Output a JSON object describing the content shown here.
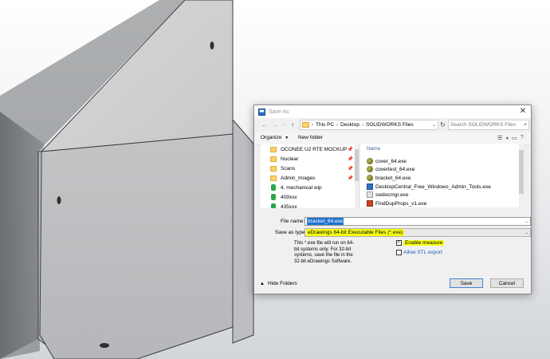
{
  "colors": {
    "selection": "#1f73d1",
    "highlight": "#f7ff16",
    "link": "#1b5fb4",
    "folder": "#ffd36b",
    "part_face": "#cfd0d2"
  },
  "dialog": {
    "title": "Save As",
    "close_label": "✕",
    "nav": {
      "back": "←",
      "forward": "→",
      "recent": "⌄",
      "up": "↑"
    },
    "address": {
      "crumbs": [
        "This PC",
        "Desktop",
        "SOLIDWORKS Files"
      ]
    },
    "search_placeholder": "Search SOLIDWORKS Files",
    "toolbar": {
      "organize": "Organize",
      "new_folder": "New folder"
    },
    "nav_pane": {
      "items": [
        {
          "label": "OCONEE U2 RTE MOCKUP",
          "icon": "folder-icon",
          "pinned": true
        },
        {
          "label": "Nuclear",
          "icon": "folder-icon",
          "pinned": true
        },
        {
          "label": "Scans",
          "icon": "folder-icon",
          "pinned": true
        },
        {
          "label": "Admin_Images",
          "icon": "folder-icon",
          "pinned": true
        },
        {
          "label": "4. mechanical wip",
          "icon": "sync-folder-icon",
          "pinned": false
        },
        {
          "label": "409xxx",
          "icon": "sync-folder-icon",
          "pinned": false
        },
        {
          "label": "435xxx",
          "icon": "sync-folder-icon",
          "pinned": false
        }
      ]
    },
    "file_list": {
      "column_header": "Name",
      "files": [
        {
          "name": "cover_64.exe",
          "icon": "edrawings-exe-icon"
        },
        {
          "name": "covertest_64.exe",
          "icon": "edrawings-exe-icon"
        },
        {
          "name": "bracket_64.exe",
          "icon": "edrawings-exe-icon"
        },
        {
          "name": "DesktopCentral_Free_Windows_Admin_Tools.exe",
          "icon": "desktopcentral-icon"
        },
        {
          "name": "swdocmgr.exe",
          "icon": "app-icon"
        },
        {
          "name": "FindDupProps_v1.exe",
          "icon": "finddupprops-icon"
        }
      ]
    },
    "form": {
      "file_name_label": "File name:",
      "file_name_value": "bracket_64.exe",
      "save_as_type_label": "Save as type:",
      "save_as_type_value": "eDrawings 64-bit Executable Files (*.exe)",
      "note": "This *.exe file will run on 64-bit systems only. For 32-bit systems, save the file in the 32-bit eDrawings Software.",
      "enable_measure_label": "Enable measure",
      "enable_measure_checked": true,
      "allow_stl_label": "Allow STL export",
      "allow_stl_checked": false,
      "check_mark": "✓"
    },
    "footer": {
      "hide_folders": "Hide Folders",
      "save_button": "Save",
      "cancel_button": "Cancel"
    }
  }
}
